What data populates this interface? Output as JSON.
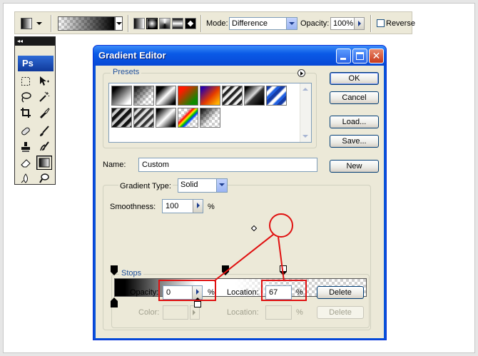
{
  "options_bar": {
    "gradient_types": [
      "linear",
      "radial",
      "angle",
      "reflected",
      "diamond"
    ],
    "selected_type": "radial",
    "mode_label": "Mode:",
    "mode_value": "Difference",
    "opacity_label": "Opacity:",
    "opacity_value": "100%",
    "reverse_label": "Reverse",
    "reverse_checked": false
  },
  "toolbox": {
    "header": "◂◂",
    "logo": "Ps",
    "tools": [
      "marquee",
      "move",
      "lasso",
      "magic-wand",
      "crop",
      "slice",
      "healing",
      "brush",
      "stamp",
      "history-brush",
      "eraser",
      "gradient",
      "blur",
      "dodge"
    ]
  },
  "dialog": {
    "title": "Gradient Editor",
    "presets_label": "Presets",
    "buttons": {
      "ok": "OK",
      "cancel": "Cancel",
      "load": "Load...",
      "save": "Save...",
      "new": "New"
    },
    "name_label": "Name:",
    "name_value": "Custom",
    "gradient_type_label": "Gradient Type:",
    "gradient_type_value": "Solid",
    "smoothness_label": "Smoothness:",
    "smoothness_value": "100",
    "smoothness_unit": "%",
    "stops": {
      "group_label": "Stops",
      "opacity_label": "Opacity:",
      "opacity_value": "0",
      "opacity_unit": "%",
      "location_label": "Location:",
      "location_value": "67",
      "location_unit": "%",
      "delete_label": "Delete",
      "color_label": "Color:",
      "color_location_label": "Location:",
      "color_location_unit": "%",
      "color_delete_label": "Delete"
    },
    "opacity_stop_locations": [
      0,
      44,
      67
    ],
    "color_stop_locations": [
      0,
      33
    ],
    "colors": {
      "title_bar": "#0a5ae6",
      "annotation": "#e01010",
      "group_title": "#1e4f9c"
    }
  }
}
